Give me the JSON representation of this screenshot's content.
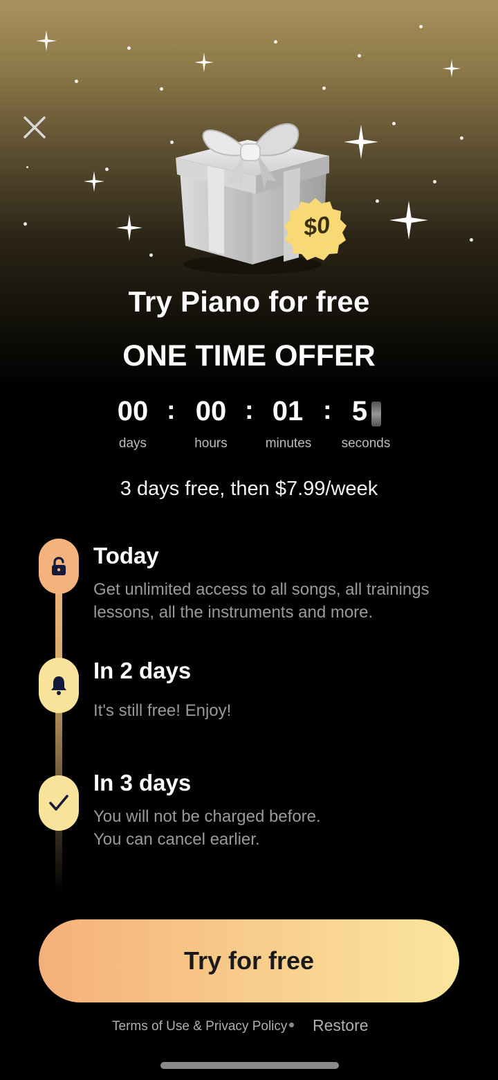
{
  "header": {
    "close_icon": "close-icon",
    "badge_text": "$0"
  },
  "hero": {
    "title": "Try Piano for free",
    "subtitle": "ONE TIME OFFER"
  },
  "countdown": {
    "days": "00",
    "hours": "00",
    "minutes": "01",
    "seconds": "5",
    "labels": {
      "days": "days",
      "hours": "hours",
      "minutes": "minutes",
      "seconds": "seconds"
    },
    "separator": ":"
  },
  "pricing": "3 days free, then $7.99/week",
  "timeline": [
    {
      "title": "Today",
      "desc": "Get unlimited access to all songs, all trainings lessons, all the instruments and more.",
      "icon": "lock-open-icon",
      "color": "#f4b27c"
    },
    {
      "title": "In 2 days",
      "desc": "It's still free! Enjoy!",
      "icon": "bell-icon",
      "color": "#f9e29a"
    },
    {
      "title": "In 3 days",
      "desc": "You will not be charged before.\nYou can cancel earlier.",
      "icon": "check-icon",
      "color": "#f9e29a"
    }
  ],
  "cta": {
    "label": "Try for free"
  },
  "footer": {
    "terms": "Terms of Use & Privacy Policy",
    "restore": "Restore"
  },
  "colors": {
    "accent_start": "#f5b07a",
    "accent_end": "#fbe59c",
    "background": "#000000"
  }
}
